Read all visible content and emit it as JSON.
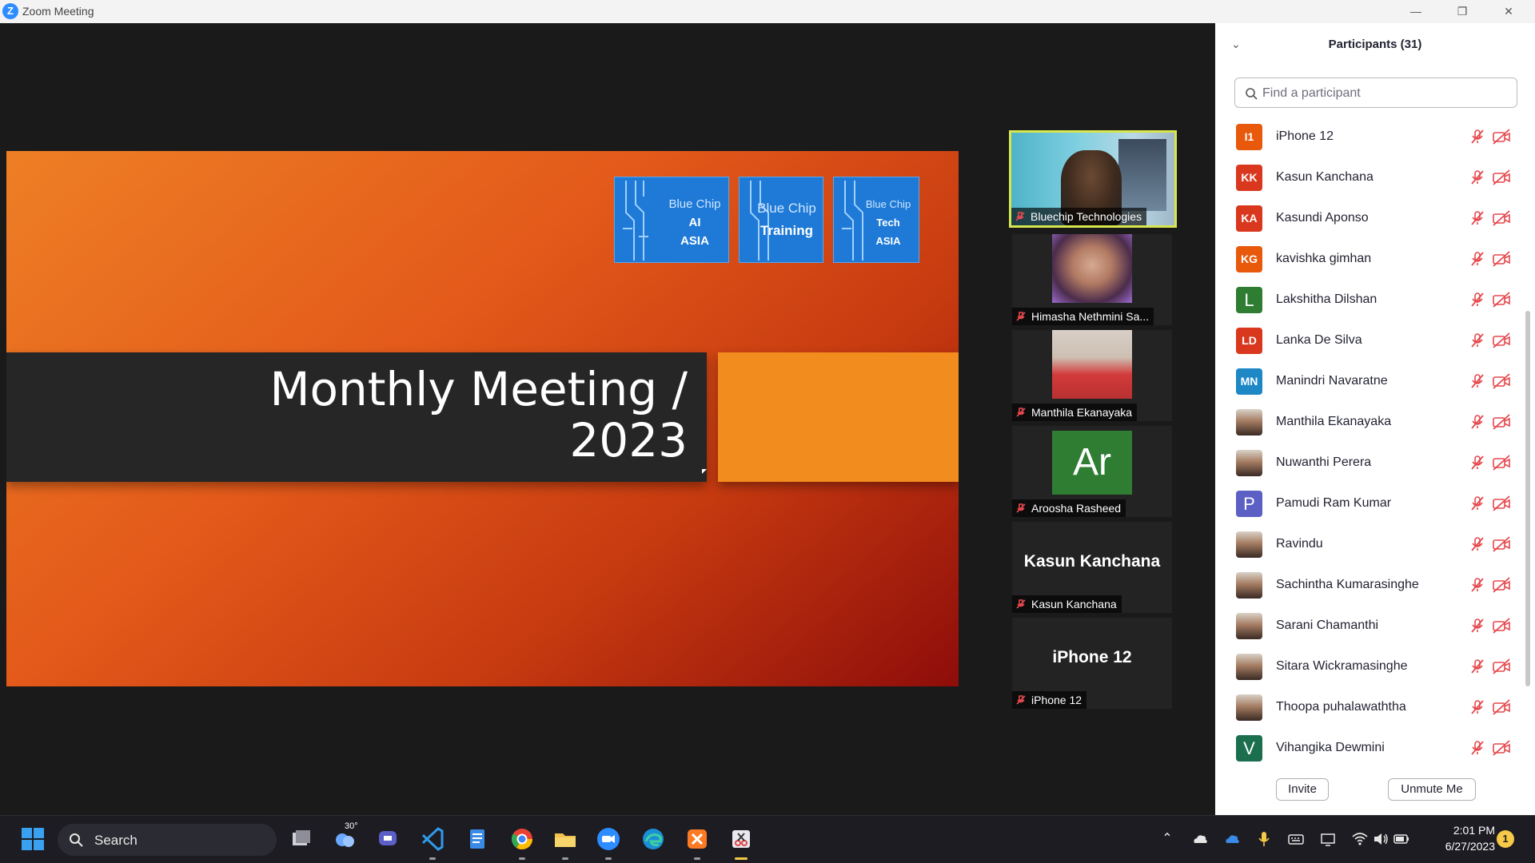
{
  "window": {
    "title": "Zoom Meeting"
  },
  "slide": {
    "title_line1": "Monthly Meeting /",
    "title_line2": "2023",
    "logos": [
      {
        "line1": "Blue Chip",
        "line2": "AI",
        "line3": "ASIA"
      },
      {
        "line1": "Blue Chip",
        "line2": "Training"
      },
      {
        "line1": "Blue Chip",
        "line2": "Tech",
        "line3": "ASIA"
      }
    ]
  },
  "videos": [
    {
      "name": "Bluechip Technologies",
      "type": "screen"
    },
    {
      "name": "Himasha Nethmini Sa...",
      "type": "photo"
    },
    {
      "name": "Manthila Ekanayaka",
      "type": "photo"
    },
    {
      "name": "Aroosha Rasheed",
      "type": "initials",
      "initials": "Ar"
    },
    {
      "name": "Kasun Kanchana",
      "type": "text",
      "display": "Kasun Kanchana"
    },
    {
      "name": "iPhone 12",
      "type": "text",
      "display": "iPhone 12"
    }
  ],
  "participants_panel": {
    "title": "Participants (31)",
    "search_placeholder": "Find a participant",
    "invite_label": "Invite",
    "unmute_label": "Unmute Me",
    "participants": [
      {
        "name": "iPhone 12",
        "initials": "I1",
        "color": "#e8590c"
      },
      {
        "name": "Kasun Kanchana",
        "initials": "KK",
        "color": "#d9381e"
      },
      {
        "name": "Kasundi Aponso",
        "initials": "KA",
        "color": "#d9381e"
      },
      {
        "name": "kavishka gimhan",
        "initials": "KG",
        "color": "#e8590c"
      },
      {
        "name": "Lakshitha Dilshan",
        "initials": "L",
        "color": "#2e7d32"
      },
      {
        "name": "Lanka De Silva",
        "initials": "LD",
        "color": "#d9381e"
      },
      {
        "name": "Manindri Navaratne",
        "initials": "MN",
        "color": "#1e88c7"
      },
      {
        "name": "Manthila Ekanayaka",
        "initials": "",
        "color": "photo"
      },
      {
        "name": "Nuwanthi Perera",
        "initials": "",
        "color": "photo"
      },
      {
        "name": "Pamudi Ram Kumar",
        "initials": "P",
        "color": "#5c5fc4"
      },
      {
        "name": "Ravindu",
        "initials": "",
        "color": "photo"
      },
      {
        "name": "Sachintha Kumarasinghe",
        "initials": "",
        "color": "photo"
      },
      {
        "name": "Sarani Chamanthi",
        "initials": "",
        "color": "photo"
      },
      {
        "name": "Sitara Wickramasinghe",
        "initials": "",
        "color": "photo"
      },
      {
        "name": "Thoopa puhalawaththa",
        "initials": "",
        "color": "photo"
      },
      {
        "name": "Vihangika Dewmini",
        "initials": "V",
        "color": "#1b6e4e"
      }
    ]
  },
  "taskbar": {
    "search_label": "Search",
    "weather_temp": "30°",
    "time": "2:01 PM",
    "date": "6/27/2023",
    "notification_count": "1"
  }
}
